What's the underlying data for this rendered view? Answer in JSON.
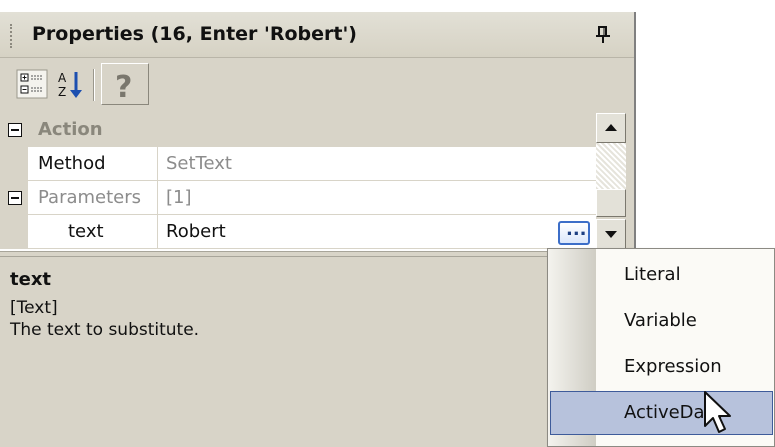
{
  "panel": {
    "title": "Properties (16, Enter 'Robert')"
  },
  "grid": {
    "category": "Action",
    "rows": [
      {
        "name": "Method",
        "value": "SetText"
      },
      {
        "name": "Parameters",
        "value": "[1]"
      },
      {
        "name": "text",
        "value": "Robert"
      }
    ]
  },
  "description": {
    "title": "text",
    "type": "[Text]",
    "text": "The text to substitute."
  },
  "menu": {
    "items": [
      "Literal",
      "Variable",
      "Expression",
      "ActiveData"
    ],
    "selected": "ActiveData"
  },
  "icons": {
    "pin": "pin-icon",
    "categorized": "categorized-icon",
    "alphabetical": "sort-alphabetical-icon",
    "help": "help-icon",
    "ellipsis": "ellipsis-icon",
    "cursor": "mouse-pointer-icon"
  },
  "colors": {
    "selection": "#b7c2dc",
    "selection_border": "#3e5b9a",
    "ellipsis_border": "#3c6ec8"
  }
}
